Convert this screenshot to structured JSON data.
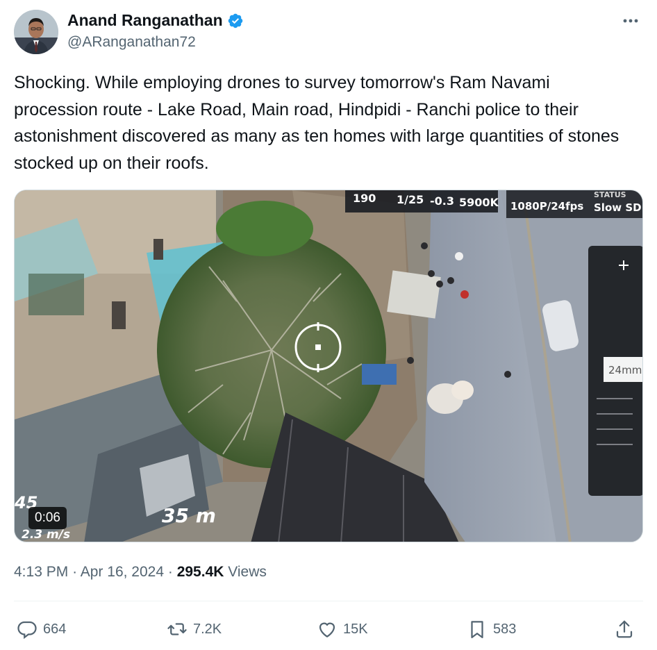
{
  "author": {
    "display_name": "Anand Ranganathan",
    "handle": "@ARanganathan72",
    "verified": true
  },
  "tweet": {
    "text": "Shocking. While employing drones to survey tomorrow's Ram Navami procession route - Lake Road, Main road, Hindpidi - Ranchi police to their astonishment discovered as many as ten homes with large quantities of stones stocked up on their roofs."
  },
  "video": {
    "duration": "0:06",
    "hud": {
      "iso": "190",
      "shutter": "1/25",
      "ev": "-0.3",
      "wb": "5900K",
      "status_label": "STATUS",
      "resolution": "1080P/24fps",
      "mode": "Slow SD",
      "focal": "24mm",
      "distance": "35 m",
      "speed": "2.3 m/s",
      "altitude_partial": "45"
    }
  },
  "meta": {
    "time": "4:13 PM",
    "separator": "·",
    "date": "Apr 16, 2024",
    "views_count": "295.4K",
    "views_label": "Views"
  },
  "actions": {
    "replies": "664",
    "reposts": "7.2K",
    "likes": "15K",
    "bookmarks": "583"
  },
  "colors": {
    "verified_blue": "#1d9bf0",
    "text_primary": "#0f1419",
    "text_secondary": "#536471"
  }
}
